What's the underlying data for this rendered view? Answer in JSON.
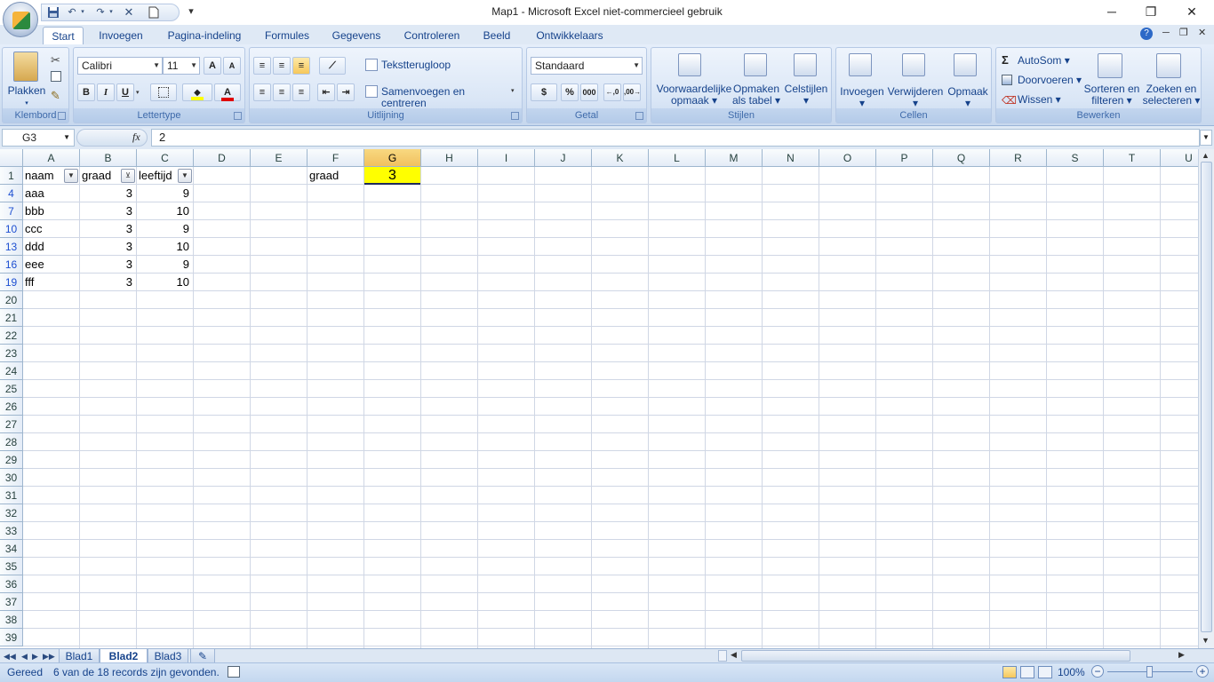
{
  "window": {
    "title": "Map1 - Microsoft Excel niet-commercieel gebruik",
    "minimize_glyph": "─",
    "restore_glyph": "❐",
    "close_glyph": "✕"
  },
  "qat": {
    "save_icon": "save-icon",
    "undo_icon": "undo-icon",
    "redo_icon": "redo-icon",
    "clear_glyph": "✕",
    "new_icon": "new-document-icon",
    "customize_glyph": "▾"
  },
  "tabs": [
    "Start",
    "Invoegen",
    "Pagina-indeling",
    "Formules",
    "Gegevens",
    "Controleren",
    "Beeld",
    "Ontwikkelaars"
  ],
  "ribbon": {
    "clipboard": {
      "label": "Klembord",
      "paste": "Plakken"
    },
    "font": {
      "label": "Lettertype",
      "name": "Calibri",
      "size": "11",
      "bold": "B",
      "italic": "I",
      "underline": "U",
      "grow": "A",
      "shrink": "A"
    },
    "alignment": {
      "label": "Uitlijning",
      "wrap": "Tekstterugloop",
      "merge": "Samenvoegen en centreren"
    },
    "number": {
      "label": "Getal",
      "format": "Standaard",
      "percent": "%",
      "thousands": "000"
    },
    "styles": {
      "label": "Stijlen",
      "conditional_1": "Voorwaardelijke",
      "conditional_2": "opmaak",
      "astable_1": "Opmaken",
      "astable_2": "als tabel",
      "cellstyles": "Celstijlen"
    },
    "cells": {
      "label": "Cellen",
      "insert": "Invoegen",
      "delete": "Verwijderen",
      "format": "Opmaak"
    },
    "editing": {
      "label": "Bewerken",
      "autosum": "AutoSom",
      "fill": "Doorvoeren",
      "clear": "Wissen",
      "sort_1": "Sorteren en",
      "sort_2": "filteren",
      "find_1": "Zoeken en",
      "find_2": "selecteren",
      "sigma": "Σ"
    }
  },
  "formula_bar": {
    "name_box": "G3",
    "fx": "fx",
    "value": "2"
  },
  "grid": {
    "columns": [
      "A",
      "B",
      "C",
      "D",
      "E",
      "F",
      "G",
      "H",
      "I",
      "J",
      "K",
      "L",
      "M",
      "N",
      "O",
      "P",
      "Q",
      "R",
      "S",
      "T",
      "U"
    ],
    "selected_column": "G",
    "rows": [
      "1",
      "4",
      "7",
      "10",
      "13",
      "16",
      "19",
      "20",
      "21",
      "22",
      "23",
      "24",
      "25",
      "26",
      "27",
      "28",
      "29",
      "30",
      "31",
      "32",
      "33",
      "34",
      "35",
      "36",
      "37",
      "38",
      "39"
    ],
    "filtered_rows": [
      "4",
      "7",
      "10",
      "13",
      "16",
      "19"
    ],
    "header": {
      "naam": "naam",
      "graad": "graad",
      "leeftijd": "leeftijd"
    },
    "data": [
      {
        "naam": "aaa",
        "graad": "3",
        "leeftijd": "9"
      },
      {
        "naam": "bbb",
        "graad": "3",
        "leeftijd": "10"
      },
      {
        "naam": "ccc",
        "graad": "3",
        "leeftijd": "9"
      },
      {
        "naam": "ddd",
        "graad": "3",
        "leeftijd": "10"
      },
      {
        "naam": "eee",
        "graad": "3",
        "leeftijd": "9"
      },
      {
        "naam": "fff",
        "graad": "3",
        "leeftijd": "10"
      }
    ],
    "f1": "graad",
    "g1": "3",
    "highlight_color": "#ffff00"
  },
  "sheets": [
    "Blad1",
    "Blad2",
    "Blad3"
  ],
  "active_sheet": "Blad2",
  "status": {
    "ready": "Gereed",
    "records": "6 van de 18 records zijn gevonden.",
    "zoom": "100%",
    "minus": "−",
    "plus": "+"
  }
}
